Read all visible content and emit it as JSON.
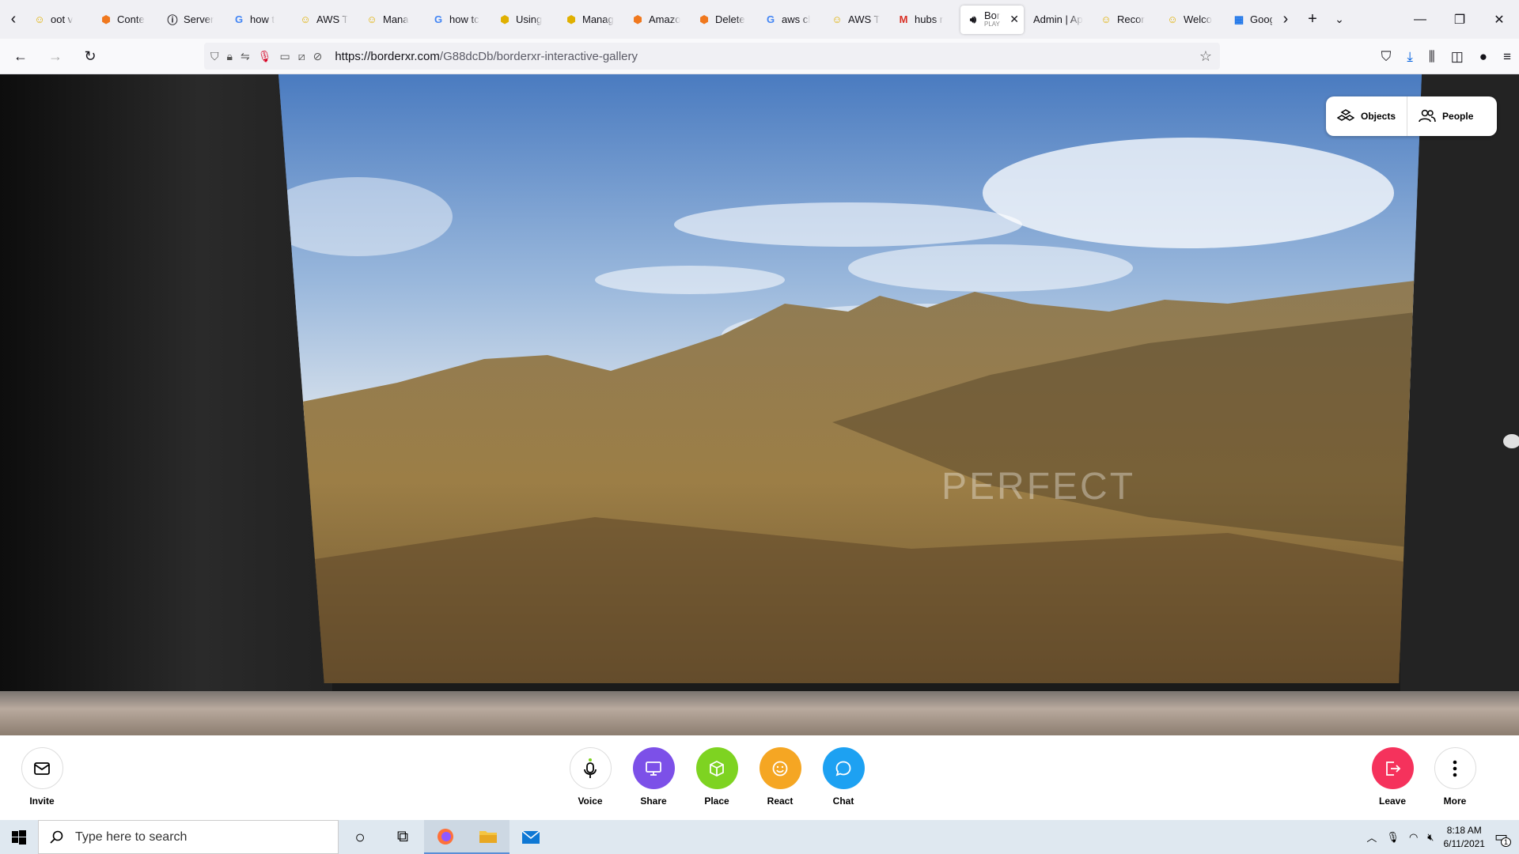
{
  "tabs": [
    {
      "label": "oot v",
      "icon": "yellow-person-icon"
    },
    {
      "label": "Conte",
      "icon": "orange-cube-icon"
    },
    {
      "label": "Server",
      "icon": "info-icon"
    },
    {
      "label": "how t",
      "icon": "google-icon"
    },
    {
      "label": "AWS T",
      "icon": "yellow-person-icon"
    },
    {
      "label": "Mana",
      "icon": "yellow-person-icon"
    },
    {
      "label": "how tc",
      "icon": "google-icon"
    },
    {
      "label": "Using",
      "icon": "yellow-cube-icon"
    },
    {
      "label": "Manag",
      "icon": "yellow-cube-icon"
    },
    {
      "label": "Amazo",
      "icon": "orange-cube-icon"
    },
    {
      "label": "Delete",
      "icon": "orange-cube-icon"
    },
    {
      "label": "aws cl",
      "icon": "google-icon"
    },
    {
      "label": "AWS T",
      "icon": "yellow-person-icon"
    },
    {
      "label": "hubs r",
      "icon": "gmail-icon"
    },
    {
      "label": "Bor",
      "sub": "PLAY",
      "icon": "speaker-icon",
      "active": true
    },
    {
      "label": "Admin | Ap",
      "icon": ""
    },
    {
      "label": "Recor",
      "icon": "yellow-person-icon"
    },
    {
      "label": "Welco",
      "icon": "yellow-person-icon"
    },
    {
      "label": "Googl",
      "icon": "calendar-icon"
    }
  ],
  "navbar": {
    "url_host": "https://borderxr.com",
    "url_path": "/G88dcDb/borderxr-interactive-gallery"
  },
  "scene": {
    "watermark": "PERFECT"
  },
  "object_panel": {
    "objects_label": "Objects",
    "people_label": "People"
  },
  "toolbar": {
    "invite_label": "Invite",
    "voice_label": "Voice",
    "share_label": "Share",
    "place_label": "Place",
    "react_label": "React",
    "chat_label": "Chat",
    "leave_label": "Leave",
    "more_label": "More",
    "colors": {
      "share": "#7c50e8",
      "place": "#7ed321",
      "react": "#f5a623",
      "chat": "#1da1f2",
      "leave": "#f5325c"
    }
  },
  "taskbar": {
    "search_placeholder": "Type here to search",
    "time": "8:18 AM",
    "date": "6/11/2021",
    "notification_count": "1"
  }
}
